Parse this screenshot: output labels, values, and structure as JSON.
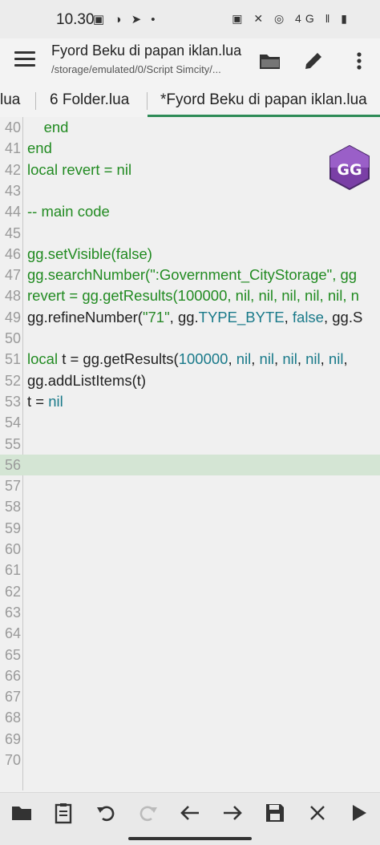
{
  "status_bar": {
    "time": "10.30",
    "left_icons": "▣ ◑ ➤ •",
    "right_icons": "▣ ✕ ◎ 4G ‖ ▮"
  },
  "app_bar": {
    "title": "Fyord Beku di papan iklan.lua",
    "subtitle": "/storage/emulated/0/Script Simcity/..."
  },
  "tabs": [
    {
      "label": "lua"
    },
    {
      "label": "6 Folder.lua"
    },
    {
      "label": "*Fyord Beku di papan iklan.lua",
      "active": true
    }
  ],
  "editor": {
    "lines": [
      {
        "n": "40",
        "html": "    <span class='kw'>end</span>"
      },
      {
        "n": "41",
        "html": "<span class='kw'>end</span>"
      },
      {
        "n": "42",
        "html": "<span class='kw'>local revert = nil</span>"
      },
      {
        "n": "43",
        "html": ""
      },
      {
        "n": "44",
        "html": "<span class='kw'>-- main code</span>"
      },
      {
        "n": "45",
        "html": ""
      },
      {
        "n": "46",
        "html": "<span class='kw'>gg.setVisible(false)</span>"
      },
      {
        "n": "47",
        "html": "<span class='kw'>gg.searchNumber(\":Government_CityStorage\", gg</span>"
      },
      {
        "n": "48",
        "html": "<span class='kw'>revert = gg.getResults(100000, nil, nil, nil, nil, nil, n</span>"
      },
      {
        "n": "49",
        "html": "gg.refineNumber(<span class='str'>\"71\"</span>, gg.<span class='num'>TYPE_BYTE</span>, <span class='num'>false</span>, gg.S"
      },
      {
        "n": "50",
        "html": ""
      },
      {
        "n": "51",
        "html": "<span class='kw'>local</span> t = gg.getResults(<span class='num'>100000</span>, <span class='num'>nil</span>, <span class='num'>nil</span>, <span class='num'>nil</span>, <span class='num'>nil</span>, <span class='num'>nil</span>,"
      },
      {
        "n": "52",
        "html": "gg.addListItems(t)"
      },
      {
        "n": "53",
        "html": "t = <span class='num'>nil</span>"
      },
      {
        "n": "54",
        "html": ""
      },
      {
        "n": "55",
        "html": ""
      },
      {
        "n": "56",
        "html": "",
        "highlight": true
      },
      {
        "n": "57",
        "html": ""
      },
      {
        "n": "58",
        "html": ""
      },
      {
        "n": "59",
        "html": ""
      },
      {
        "n": "60",
        "html": ""
      },
      {
        "n": "61",
        "html": ""
      },
      {
        "n": "62",
        "html": ""
      },
      {
        "n": "63",
        "html": ""
      },
      {
        "n": "64",
        "html": ""
      },
      {
        "n": "65",
        "html": ""
      },
      {
        "n": "66",
        "html": ""
      },
      {
        "n": "67",
        "html": ""
      },
      {
        "n": "68",
        "html": ""
      },
      {
        "n": "69",
        "html": ""
      },
      {
        "n": "70",
        "html": ""
      }
    ]
  },
  "overlay": {
    "logo_text": "GG"
  },
  "colors": {
    "keyword_green": "#228b22",
    "number_teal": "#1a7a8a",
    "tab_accent": "#2e8b57",
    "highlight_line": "#d4e5d4"
  },
  "toolbar_icons": [
    "folder-icon",
    "clipboard-icon",
    "undo-icon",
    "redo-icon",
    "arrow-left-icon",
    "arrow-right-icon",
    "save-icon",
    "close-icon",
    "play-icon"
  ]
}
